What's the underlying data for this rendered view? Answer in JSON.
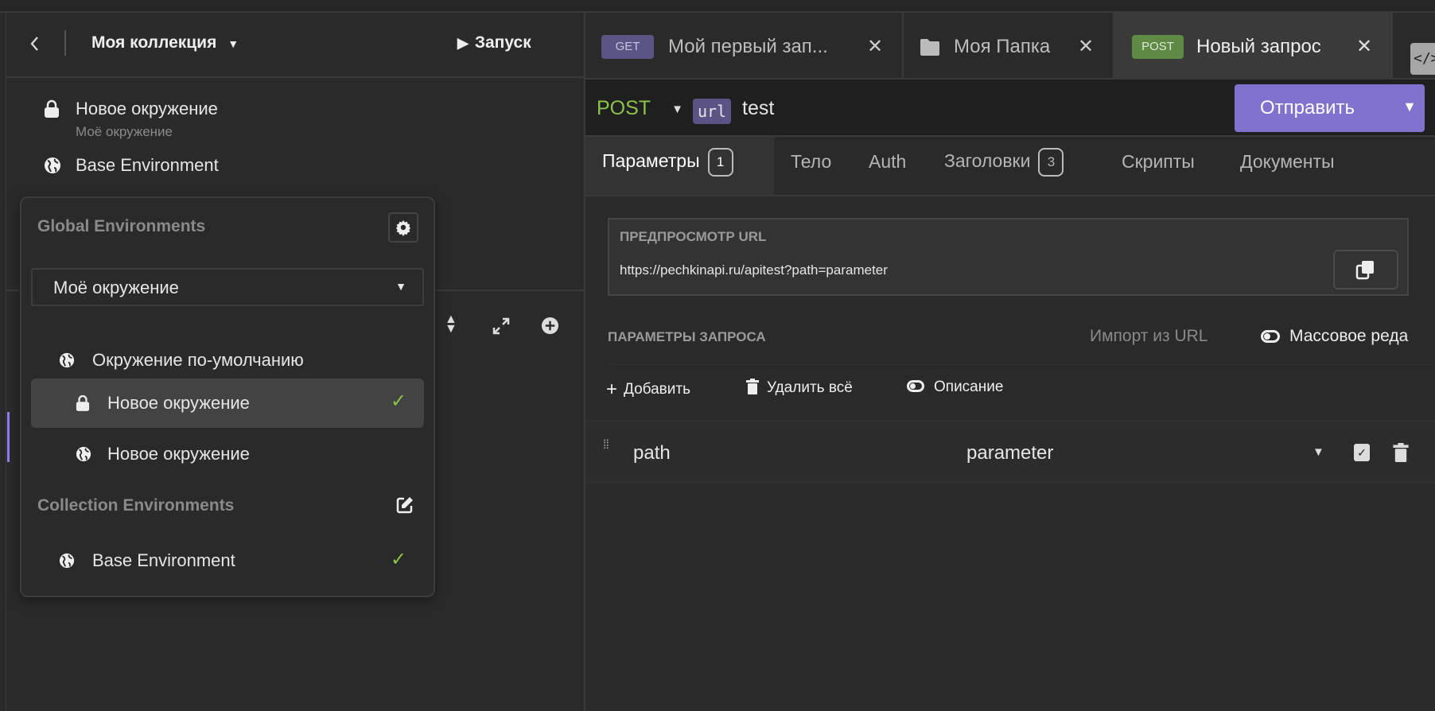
{
  "sidebar": {
    "back_icon": "chevron-left-icon",
    "collection_title": "Моя коллекция",
    "run_label": "Запуск",
    "active_env": {
      "name": "Новое окружение",
      "subtitle": "Моё окружение"
    },
    "base_env": "Base Environment"
  },
  "env_dropdown": {
    "global_heading": "Global Environments",
    "selected_workspace": "Моё окружение",
    "items": [
      {
        "label": "Окружение по-умолчанию",
        "icon": "globe-icon",
        "checked": false
      },
      {
        "label": "Новое окружение",
        "icon": "lock-icon",
        "checked": true
      },
      {
        "label": "Новое окружение",
        "icon": "globe-icon",
        "checked": false
      }
    ],
    "collection_heading": "Collection Environments",
    "collection_items": [
      {
        "label": "Base Environment",
        "icon": "globe-icon",
        "checked": true
      }
    ]
  },
  "tabs": [
    {
      "method": "GET",
      "label": "Мой первый зап...",
      "color": "#5b5585"
    },
    {
      "icon": "folder-icon",
      "label": "Моя Папка"
    },
    {
      "method": "POST",
      "label": "Новый запрос",
      "color": "#5e8a45",
      "active": true
    }
  ],
  "request": {
    "method": "POST",
    "method_color": "#8bc34a",
    "url_var": "url",
    "url_rest": "test",
    "send_label": "Отправить",
    "send_color": "#8272cf"
  },
  "request_tabs": [
    {
      "label": "Параметры",
      "count": "1",
      "active": true
    },
    {
      "label": "Тело"
    },
    {
      "label": "Auth"
    },
    {
      "label": "Заголовки",
      "count": "3"
    },
    {
      "label": "Скрипты"
    },
    {
      "label": "Документы"
    }
  ],
  "preview": {
    "heading": "ПРЕДПРОСМОТР URL",
    "url": "https://pechkinapi.ru/apitest?path=parameter"
  },
  "params": {
    "heading": "ПАРАМЕТРЫ ЗАПРОСА",
    "import_label": "Импорт из URL",
    "bulk_label": "Массовое реда",
    "add_label": "Добавить",
    "delete_all_label": "Удалить всё",
    "description_label": "Описание",
    "rows": [
      {
        "name": "path",
        "value": "parameter",
        "enabled": true
      }
    ]
  }
}
